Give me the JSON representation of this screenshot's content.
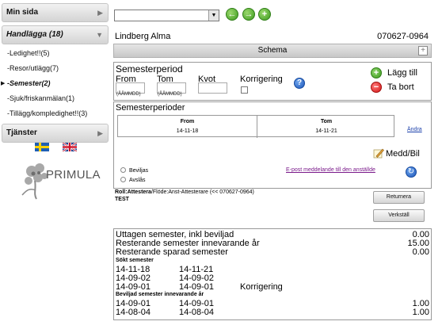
{
  "sidebar": {
    "sections": [
      {
        "label": "Min sida",
        "arrow": "▶"
      },
      {
        "label": "Handlägga (18)",
        "arrow": "▼"
      },
      {
        "label": "Tjänster",
        "arrow": "▶"
      }
    ],
    "items": [
      {
        "label": "-Ledighet!!(5)"
      },
      {
        "label": "-Resor/utlägg(7)"
      },
      {
        "label": "-Semester(2)",
        "active": true
      },
      {
        "label": "-Sjuk/friskanmälan(1)"
      },
      {
        "label": "-Tillägg/kompledighet!!(3)"
      }
    ],
    "logo_text": "PRIMULA"
  },
  "toolbar": {
    "select_value": "",
    "icons": [
      "back-arrow-icon",
      "forward-arrow-icon",
      "add-icon"
    ]
  },
  "person": {
    "name": "Lindberg Alma",
    "id": "070627-0964"
  },
  "schema": {
    "label": "Schema",
    "expand_icon": "+"
  },
  "semesterperiod": {
    "title": "Semesterperiod",
    "from_label": "From",
    "tom_label": "Tom",
    "kvot_label": "Kvot",
    "korrigering_label": "Korrigering",
    "date_hint": "(ÅÅMMDD)",
    "add_label": "Lägg till",
    "remove_label": "Ta bort"
  },
  "semesterperioder": {
    "title": "Semesterperioder",
    "columns": [
      "From",
      "Tom"
    ],
    "rows": [
      [
        "14-11-18",
        "14-11-21"
      ]
    ],
    "change_link": "Ändra",
    "medd_label": "Medd/Bil",
    "radio_beviljas": "Beviljas",
    "radio_avslas": "Avslås",
    "email_link": "E-post meddelande till den anställde"
  },
  "role": {
    "prefix": "Roll:",
    "role_value": "Attestera",
    "flow": "/Flöde:Anst-Attesterare (<< 070627-0964)",
    "test": "TEST"
  },
  "buttons": {
    "returnera": "Returnera",
    "verkstall": "Verkställ"
  },
  "summary": {
    "rows": [
      {
        "label": "Uttagen semester, inkl beviljad",
        "value": "0.00"
      },
      {
        "label": "Resterande semester innevarande år",
        "value": "15.00"
      },
      {
        "label": "Resterande sparad semester",
        "value": "0.00"
      }
    ],
    "sokt_title": "Sökt semester",
    "sokt_rows": [
      {
        "from": "14-11-18",
        "tom": "14-11-21",
        "note": ""
      },
      {
        "from": "14-09-02",
        "tom": "14-09-02",
        "note": ""
      },
      {
        "from": "14-09-01",
        "tom": "14-09-01",
        "note": "Korrigering"
      }
    ],
    "beviljad_title": "Beviljad semester innevarande år",
    "beviljad_rows": [
      {
        "from": "14-09-01",
        "tom": "14-09-01",
        "value": "1.00"
      },
      {
        "from": "14-08-04",
        "tom": "14-08-04",
        "value": "1.00"
      }
    ]
  }
}
